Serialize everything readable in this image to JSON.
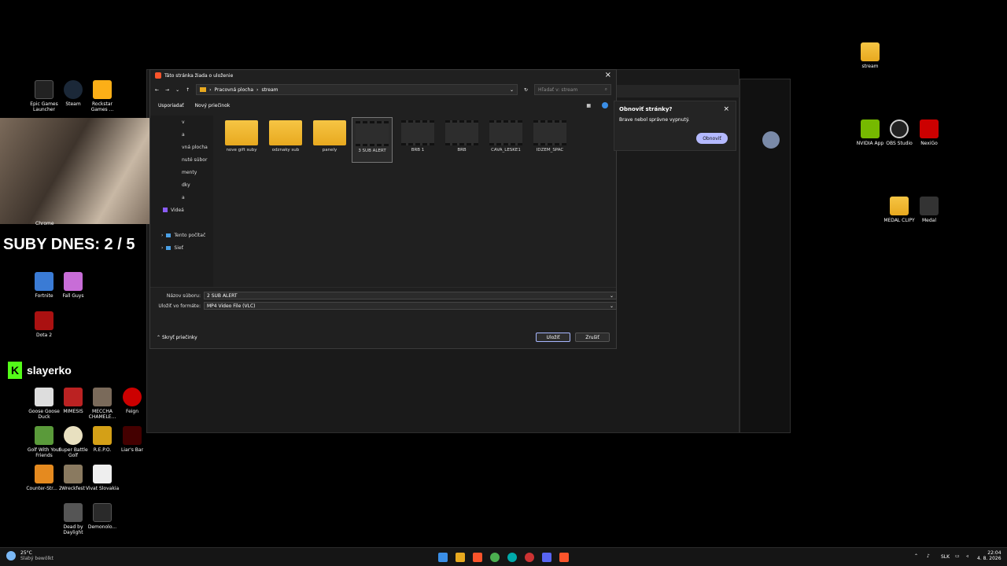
{
  "desktop": {
    "left_icons": [
      {
        "label": "Epic Games Launcher"
      },
      {
        "label": "Steam"
      },
      {
        "label": "Rockstar Games ..."
      },
      {
        "label": "Fortnite"
      },
      {
        "label": "Fall Guys"
      },
      {
        "label": "Dota 2"
      },
      {
        "label": "Goose Goose Duck"
      },
      {
        "label": "MIMESIS"
      },
      {
        "label": "MECCHA CHAMELE..."
      },
      {
        "label": "Feign"
      },
      {
        "label": "Golf With Your Friends"
      },
      {
        "label": "Super Battle Golf"
      },
      {
        "label": "R.E.P.O."
      },
      {
        "label": "Liar's Bar"
      },
      {
        "label": "Counter-Str... 2"
      },
      {
        "label": "Wreckfest"
      },
      {
        "label": "Vivat Slovakia"
      },
      {
        "label": "Dead by Daylight"
      },
      {
        "label": "Demonolo..."
      }
    ],
    "chrome_label": "Chrome",
    "right_icons": [
      {
        "label": "stream"
      },
      {
        "label": "NVIDIA App"
      },
      {
        "label": "OBS Studio"
      },
      {
        "label": "NexiGo"
      },
      {
        "label": "MEDAL CLIPY"
      },
      {
        "label": "Medal"
      }
    ]
  },
  "overlay": {
    "subs_text": "SUBY DNES: 2 / 5",
    "kick_name": "slayerko",
    "kick_letter": "K"
  },
  "dialog": {
    "title": "Táto stránka žiada o uloženie",
    "breadcrumb": [
      "Pracovná plocha",
      "stream"
    ],
    "search_placeholder": "Hľadať v: stream",
    "cmd_organize": "Usporiadať",
    "cmd_new_folder": "Nový priečinok",
    "nav_items": [
      "v",
      "a",
      "vná plocha",
      "nuté súbor",
      "menty",
      "dky",
      "a",
      "Videá"
    ],
    "nav_tree": [
      "Tento počítač",
      "Sieť"
    ],
    "files": [
      {
        "name": "nove gift suby",
        "kind": "folder"
      },
      {
        "name": "odznaky sub",
        "kind": "folder"
      },
      {
        "name": "panely",
        "kind": "folder"
      },
      {
        "name": "3 SUB ALERT",
        "kind": "video",
        "selected": true
      },
      {
        "name": "BRB 1",
        "kind": "video"
      },
      {
        "name": "BRB",
        "kind": "video"
      },
      {
        "name": "CAVA_LESKE1",
        "kind": "video"
      },
      {
        "name": "IDZEM_SPAC",
        "kind": "video"
      }
    ],
    "filename_label": "Názov súboru:",
    "filename_value": "2 SUB ALERT",
    "filetype_label": "Uložiť vo formáte:",
    "filetype_value": "MP4 Video File (VLC)",
    "hide_folders": "Skryť priečinky",
    "save": "Uložiť",
    "cancel": "Zrušiť"
  },
  "popup": {
    "title": "Obnoviť stránky?",
    "body": "Brave nebol správne vypnutý.",
    "button": "Obnoviť"
  },
  "taskbar": {
    "weather_temp": "25°C",
    "weather_desc": "Slabý bewölkt",
    "lang": "SLK",
    "time": "22:04",
    "date": "4. 8. 2026"
  }
}
